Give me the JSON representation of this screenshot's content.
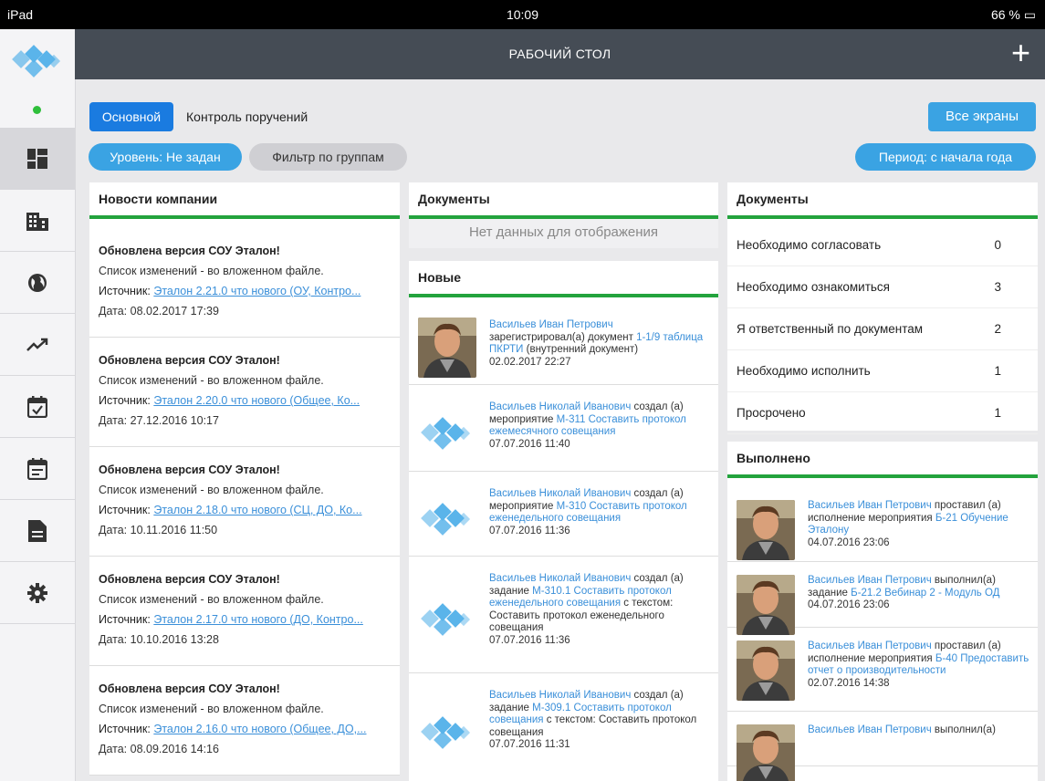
{
  "status": {
    "left": "iPad",
    "time": "10:09",
    "battery": "66 %"
  },
  "header": {
    "title": "РАБОЧИЙ СТОЛ",
    "add": "+"
  },
  "sidebar": {
    "icons": [
      "dashboard-icon",
      "building-icon",
      "globe-icon",
      "trend-icon",
      "calendar-check-icon",
      "calendar-list-icon",
      "document-icon",
      "gear-icon"
    ]
  },
  "tabs": {
    "main": "Основной",
    "control": "Контроль поручений",
    "all_screens": "Все экраны"
  },
  "filters": {
    "level": "Уровень: Не задан",
    "groups": "Фильтр по группам",
    "period": "Период: с начала года"
  },
  "news": {
    "title": "Новости компании",
    "items": [
      {
        "title": "Обновлена версия СОУ Эталон!",
        "desc": "Список изменений - во вложенном файле.",
        "src_label": "Источник:",
        "src": "Эталон 2.21.0 что нового (ОУ, Контро...",
        "date": "Дата: 08.02.2017 17:39"
      },
      {
        "title": "Обновлена версия СОУ Эталон!",
        "desc": "Список изменений - во вложенном файле.",
        "src_label": "Источник:",
        "src": "Эталон 2.20.0 что нового (Общее, Ко...",
        "date": "Дата: 27.12.2016 10:17"
      },
      {
        "title": "Обновлена версия СОУ Эталон!",
        "desc": "Список изменений - во вложенном файле.",
        "src_label": "Источник:",
        "src": "Эталон 2.18.0 что нового (СЦ, ДО, Ко...",
        "date": "Дата: 10.11.2016 11:50"
      },
      {
        "title": "Обновлена версия СОУ Эталон!",
        "desc": "Список изменений - во вложенном файле.",
        "src_label": "Источник:",
        "src": "Эталон 2.17.0 что нового (ДО, Контро...",
        "date": "Дата: 10.10.2016 13:28"
      },
      {
        "title": "Обновлена версия СОУ Эталон!",
        "desc": "Список изменений - во вложенном файле.",
        "src_label": "Источник:",
        "src": "Эталон 2.16.0 что нового (Общее, ДО,...",
        "date": "Дата: 08.09.2016 14:16"
      }
    ]
  },
  "docs_mid": {
    "title": "Документы",
    "empty": "Нет данных для отображения"
  },
  "new_feed": {
    "title": "Новые",
    "items": [
      {
        "author": "Васильев Иван Петрович",
        "action": "зарегистрировал(а) документ",
        "link": "1-1/9 таблица ПКРТИ",
        "tail": "(внутренний документ)",
        "date": "02.02.2017 22:27"
      },
      {
        "author": "Васильев Николай Иванович",
        "action": "создал (а) мероприятие",
        "link": "М-311 Составить протокол ежемесячного совещания",
        "tail": "",
        "date": "07.07.2016 11:40"
      },
      {
        "author": "Васильев Николай Иванович",
        "action": "создал (а) мероприятие",
        "link": "М-310 Составить протокол еженедельного совещания",
        "tail": "",
        "date": "07.07.2016 11:36"
      },
      {
        "author": "Васильев Николай Иванович",
        "action": "создал (а) задание",
        "link": "М-310.1 Составить протокол еженедельного совещания",
        "tail": "с текстом: Составить протокол еженедельного совещания",
        "date": "07.07.2016 11:36"
      },
      {
        "author": "Васильев Николай Иванович",
        "action": "создал (а) задание",
        "link": "М-309.1 Составить протокол совещания",
        "tail": "с текстом: Составить протокол совещания",
        "date": "07.07.2016 11:31"
      }
    ]
  },
  "docs_right": {
    "title": "Документы",
    "rows": [
      {
        "label": "Необходимо согласовать",
        "value": "0"
      },
      {
        "label": "Необходимо ознакомиться",
        "value": "3"
      },
      {
        "label": "Я ответственный по документам",
        "value": "2"
      },
      {
        "label": "Необходимо исполнить",
        "value": "1"
      },
      {
        "label": "Просрочено",
        "value": "1"
      }
    ]
  },
  "done": {
    "title": "Выполнено",
    "items": [
      {
        "author": "Васильев Иван Петрович",
        "action": "проставил (а) исполнение мероприятия",
        "link": "Б-21 Обучение Эталону",
        "date": "04.07.2016 23:06"
      },
      {
        "author": "Васильев Иван Петрович",
        "action": "выполнил(а) задание",
        "link": "Б-21.2 Вебинар 2 - Модуль ОД",
        "date": "04.07.2016 23:06"
      },
      {
        "author": "Васильев Иван Петрович",
        "action": "проставил (а) исполнение мероприятия",
        "link": "Б-40 Предоставить отчет о производительности",
        "date": "02.07.2016 14:38"
      },
      {
        "author": "Васильев Иван Петрович",
        "action": "выполнил(а)",
        "link": "",
        "date": ""
      }
    ]
  },
  "colors": {
    "accent": "#1a7be0",
    "pill": "#3aa3e3",
    "green": "#23a33d",
    "topbar": "#454c55"
  }
}
